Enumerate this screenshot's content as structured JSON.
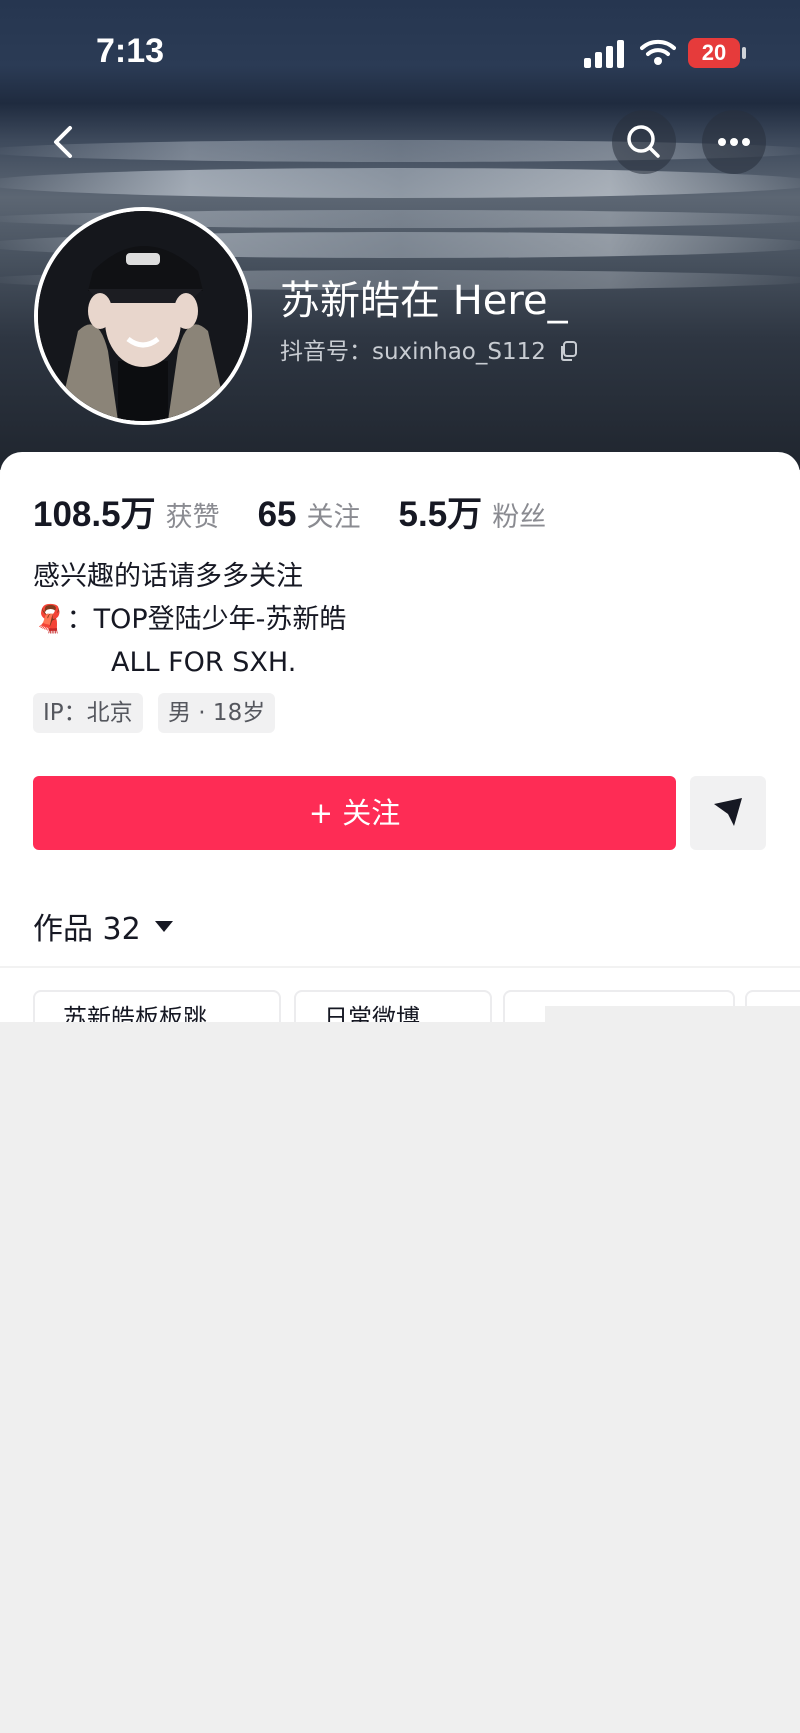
{
  "status_bar": {
    "time": "7:13",
    "battery": "20"
  },
  "profile": {
    "nickname": "苏新皓在 Here_",
    "douyin_id_label": "抖音号：suxinhao_S112",
    "stats": [
      {
        "value": "108.5万",
        "label": "获赞"
      },
      {
        "value": "65",
        "label": "关注"
      },
      {
        "value": "5.5万",
        "label": "粉丝"
      }
    ],
    "bio": {
      "line1": "感兴趣的话请多多关注",
      "line2_emoji": "🧣",
      "line2_text": "：TOP登陆少年-苏新皓",
      "line3": "ALL FOR SXH."
    },
    "tags": [
      "IP：北京",
      "男 · 18岁"
    ],
    "follow_label": "+ 关注",
    "works_label": "作品 32"
  },
  "collections": [
    "苏新皓板板跳",
    "日常微博",
    "",
    ""
  ],
  "colors": {
    "accent": "#fe2c55",
    "text": "#161823",
    "muted": "#8a8b91"
  },
  "icons": [
    "back-arrow-icon",
    "search-icon",
    "more-icon",
    "copy-icon",
    "share-arrow-icon",
    "dropdown-triangle-icon"
  ]
}
